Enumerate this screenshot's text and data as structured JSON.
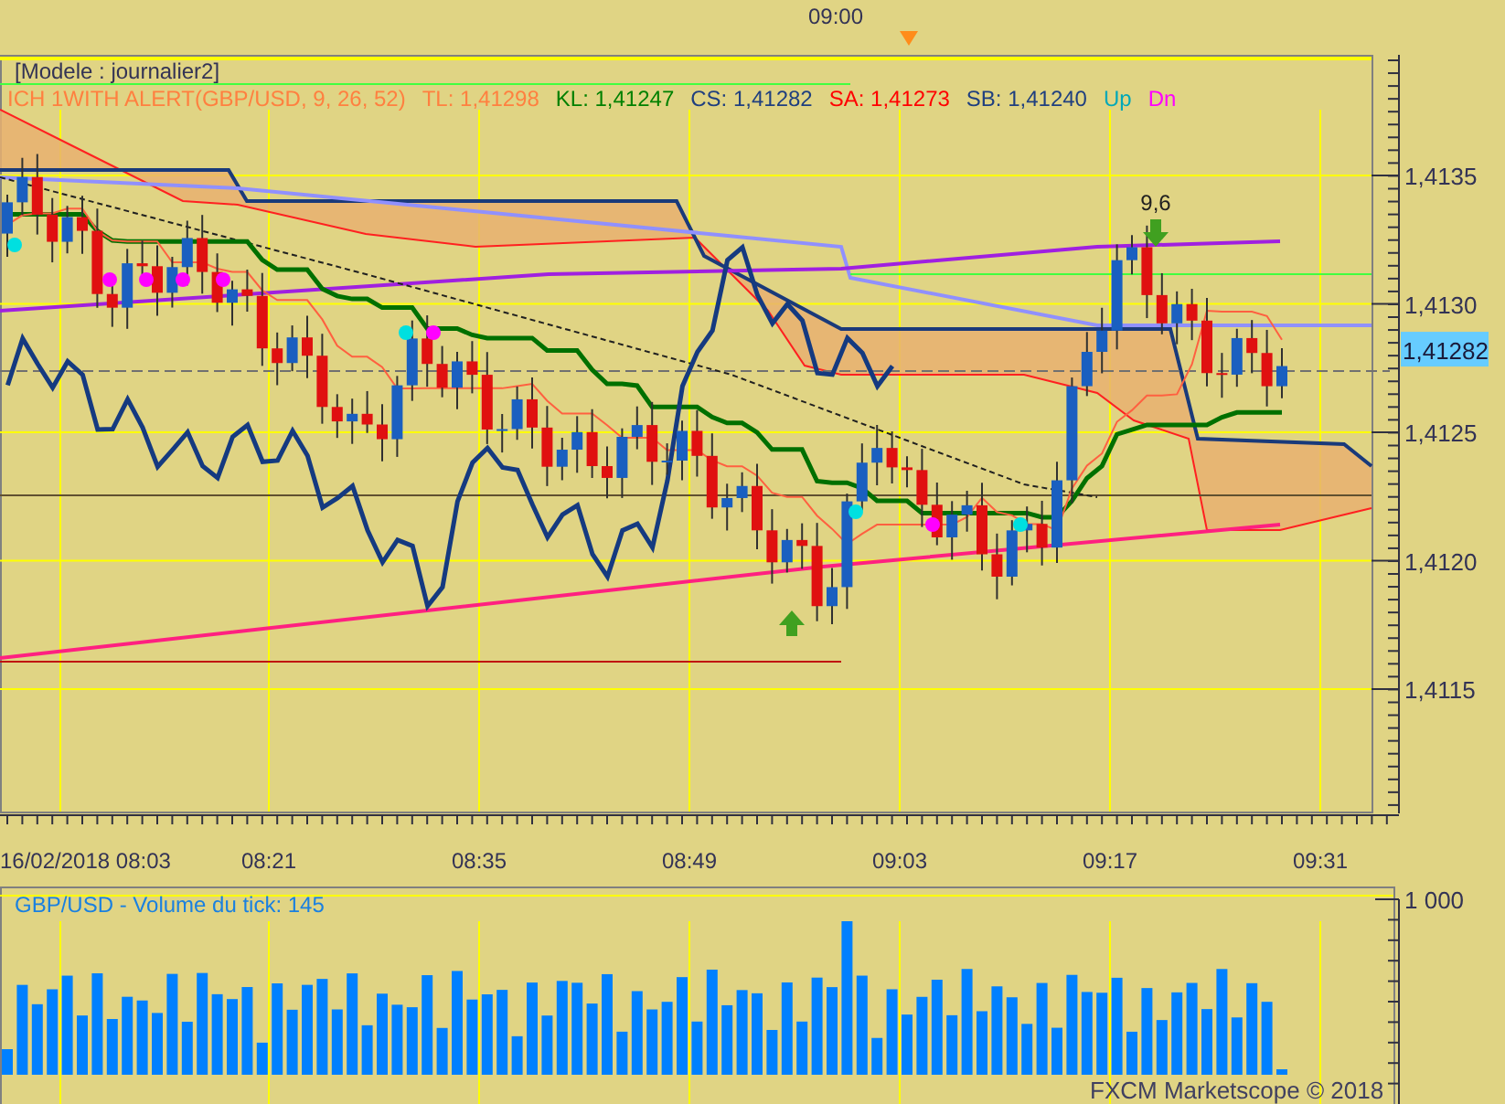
{
  "top_marker": {
    "label": "09:00"
  },
  "chart": {
    "template": "[Modele : journalier2]",
    "legend": [
      {
        "text": "ICH 1WITH ALERT(GBP/USD, 9, 26, 52)",
        "color": "#ff8040"
      },
      {
        "text": "TL: 1,41298",
        "color": "#ff8040"
      },
      {
        "text": "KL: 1,41247",
        "color": "#008000"
      },
      {
        "text": "CS: 1,41282",
        "color": "#1f3f7f"
      },
      {
        "text": "SA: 1,41273",
        "color": "#ff0000"
      },
      {
        "text": "SB: 1,41240",
        "color": "#1f3f7f"
      },
      {
        "text": "Up",
        "color": "#00a8b8"
      },
      {
        "text": "Dn",
        "color": "#ff00ff"
      }
    ],
    "annotation": "9,6",
    "price_axis": [
      "1,4135",
      "1,4130",
      "1,4125",
      "1,4120",
      "1,4115"
    ],
    "current_price": "1,41282",
    "time_axis": [
      "16/02/2018 08:03",
      "08:21",
      "08:35",
      "08:49",
      "09:03",
      "09:17",
      "09:31"
    ]
  },
  "volume": {
    "title": "GBP/USD - Volume du tick: 145",
    "axis_label": "1 000",
    "footer": "FXCM Marketscope © 2018"
  }
}
